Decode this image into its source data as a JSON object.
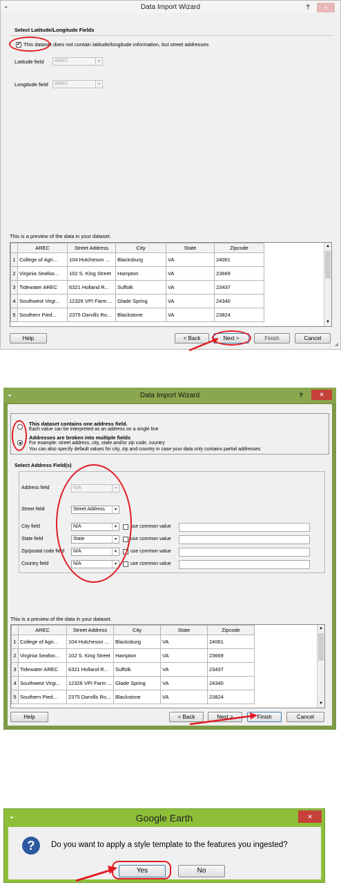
{
  "wizard1": {
    "title": "Data Import Wizard",
    "help_symbol": "?",
    "close_symbol": "×",
    "section_title": "Select Latitude/Longitude Fields",
    "no_latlong_label": "This dataset does not contain latitude/longitude information, but street addresses",
    "no_latlong_checked": true,
    "latitude_label": "Latitude field",
    "latitude_value": "AREC",
    "longitude_label": "Longitude field",
    "longitude_value": "AREC",
    "preview_label": "This is a preview of the data in your dataset.",
    "buttons": {
      "help": "Help",
      "back": "< Back",
      "next": "Next >",
      "finish": "Finish",
      "cancel": "Cancel"
    }
  },
  "wizard2": {
    "title": "Data Import Wizard",
    "help_symbol": "?",
    "close_symbol": "✕",
    "option_single_title": "This dataset contains one address field.",
    "option_single_desc": "Each value can be interpreted as an address on a single line",
    "option_multi_title": "Addresses are broken into multiple fields",
    "option_multi_desc1": "For example: street address, city, state and/or zip code, country",
    "option_multi_desc2": "You can also specify default values for city, zip and country in case your data only contains partial addresses",
    "selected_option": "multi",
    "section_title": "Select Address Field(s)",
    "fields": [
      {
        "label": "Address field",
        "value": "N/A",
        "disabled": true
      },
      {
        "label": "Street field",
        "value": "Street Address"
      },
      {
        "label": "City field",
        "value": "N/A",
        "common": "use common value"
      },
      {
        "label": "State field",
        "value": "State",
        "common": "use common value"
      },
      {
        "label": "Zip/postal code field",
        "value": "N/A",
        "common": "use common value"
      },
      {
        "label": "Country field",
        "value": "N/A",
        "common": "use common value"
      }
    ],
    "preview_label": "This is a preview of the data in your dataset.",
    "buttons": {
      "help": "Help",
      "back": "< Back",
      "next": "Next >",
      "finish": "Finish",
      "cancel": "Cancel"
    }
  },
  "preview": {
    "headers": [
      "AREC",
      "Street Address",
      "City",
      "State",
      "Zipcode"
    ],
    "rows": [
      [
        "1",
        "College of Agri...",
        "104 Hutcheson ...",
        "Blacksburg",
        "VA",
        "24061"
      ],
      [
        "2",
        "Virginia Seafoo...",
        "102 S. King Street",
        "Hampton",
        "VA",
        "23669"
      ],
      [
        "3",
        "Tidewater AREC",
        "6321 Holland R...",
        "Suffolk",
        "VA",
        "23437"
      ],
      [
        "4",
        "Southwest Virgi...",
        "12326 VPI Farm ...",
        "Glade Spring",
        "VA",
        "24340"
      ],
      [
        "5",
        "Southern Pied...",
        "2375 Darvills Ro...",
        "Blackstone",
        "VA",
        "23824"
      ]
    ]
  },
  "dialog": {
    "title": "Google Earth",
    "close_symbol": "×",
    "question": "Do you want to apply a style template to the features you ingested?",
    "yes": "Yes",
    "no": "No",
    "icon_glyph": "?"
  },
  "colors": {
    "annotation_red": "#e01b24",
    "dialog_green": "#8ebf3a",
    "question_blue": "#2c5aa0"
  }
}
